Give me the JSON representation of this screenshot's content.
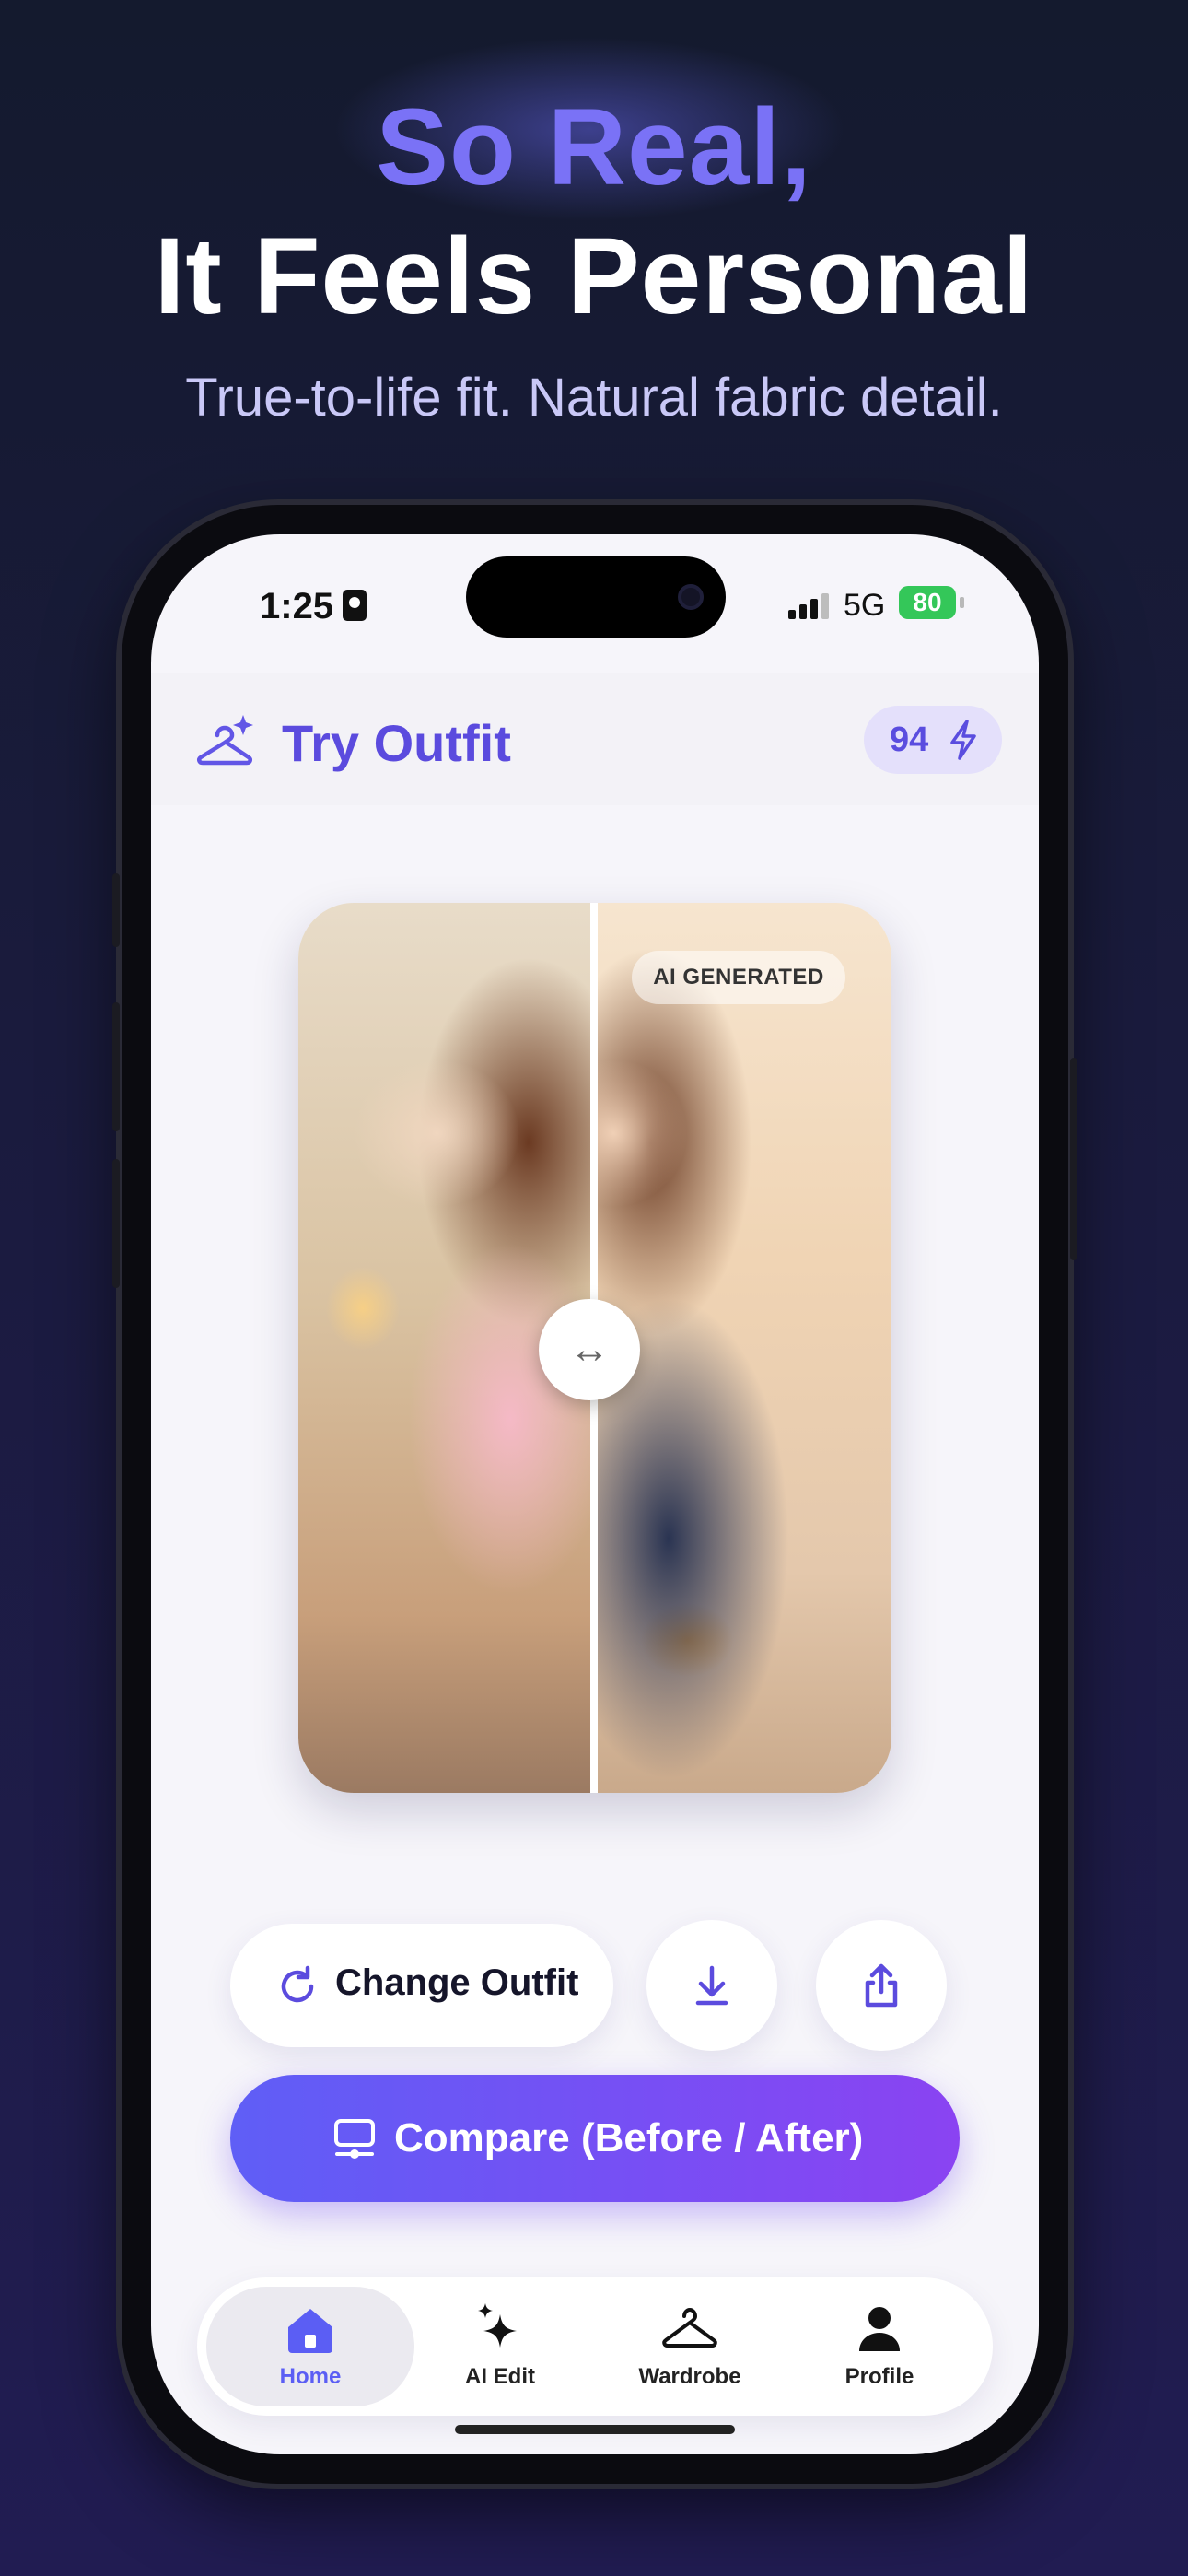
{
  "hero": {
    "line1": "So Real,",
    "line2": "It Feels Personal",
    "subtitle": "True-to-life fit. Natural fabric detail."
  },
  "status_bar": {
    "time": "1:25",
    "network": "5G",
    "battery": "80"
  },
  "app": {
    "title": "Try Outfit",
    "credits": "94",
    "badge": "AI GENERATED",
    "handle_symbol": "↔"
  },
  "actions": {
    "change_outfit": "Change Outfit",
    "download_icon": "download-icon",
    "share_icon": "share-icon",
    "compare": "Compare (Before / After)"
  },
  "tabs": [
    {
      "label": "Home",
      "icon": "home-icon",
      "active": true
    },
    {
      "label": "AI Edit",
      "icon": "sparkle-icon",
      "active": false
    },
    {
      "label": "Wardrobe",
      "icon": "hanger-icon",
      "active": false
    },
    {
      "label": "Profile",
      "icon": "person-icon",
      "active": false
    }
  ],
  "colors": {
    "accent": "#5b4bde",
    "gradient_start": "#5f5ef6",
    "gradient_end": "#8a43f2",
    "battery": "#34c759"
  }
}
